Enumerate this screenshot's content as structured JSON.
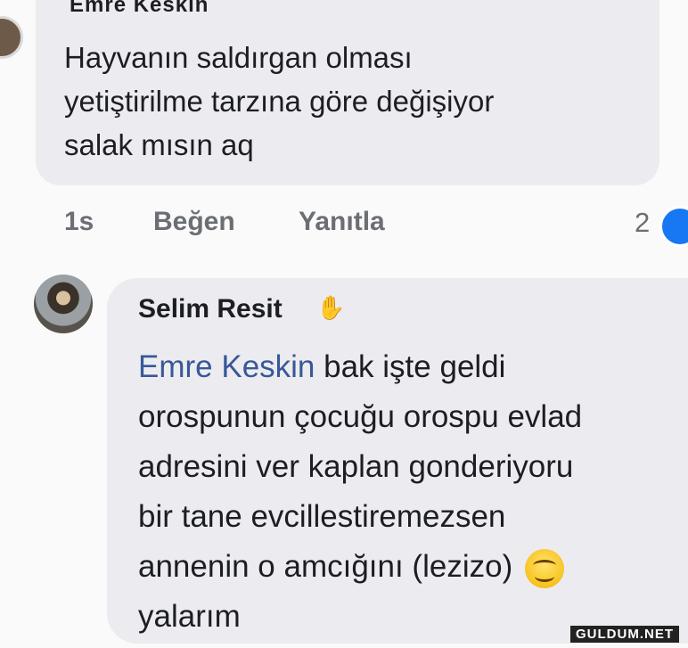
{
  "comment1": {
    "author_partial": "Emre Keskin",
    "text": "Hayvanın saldırgan olması\nyetiştirilme tarzına göre değişiyor\nsalak mısın aq",
    "time": "1s",
    "like_label": "Beğen",
    "reply_label": "Yanıtla",
    "reaction_count": "2",
    "reaction_icon": "like-reaction-icon"
  },
  "comment2": {
    "author": "Selim Resit",
    "author_badge_icon": "waving-hand-icon",
    "mention": "Emre Keskin",
    "text_after_mention": " bak işte geldi\norospunun çocuğu orospu evlad\nadresini ver kaplan gonderiyoru\nbir tane evcillestiremezsen\nannenin o amcığını (lezizo) ",
    "emoji": "smiling-face-icon",
    "text_end": "\nyalarım"
  },
  "watermark": "GULDUM.NET",
  "colors": {
    "bubble": "#ececf0",
    "mention": "#385898",
    "meta": "#6b6e73",
    "reaction": "#1877f2"
  }
}
